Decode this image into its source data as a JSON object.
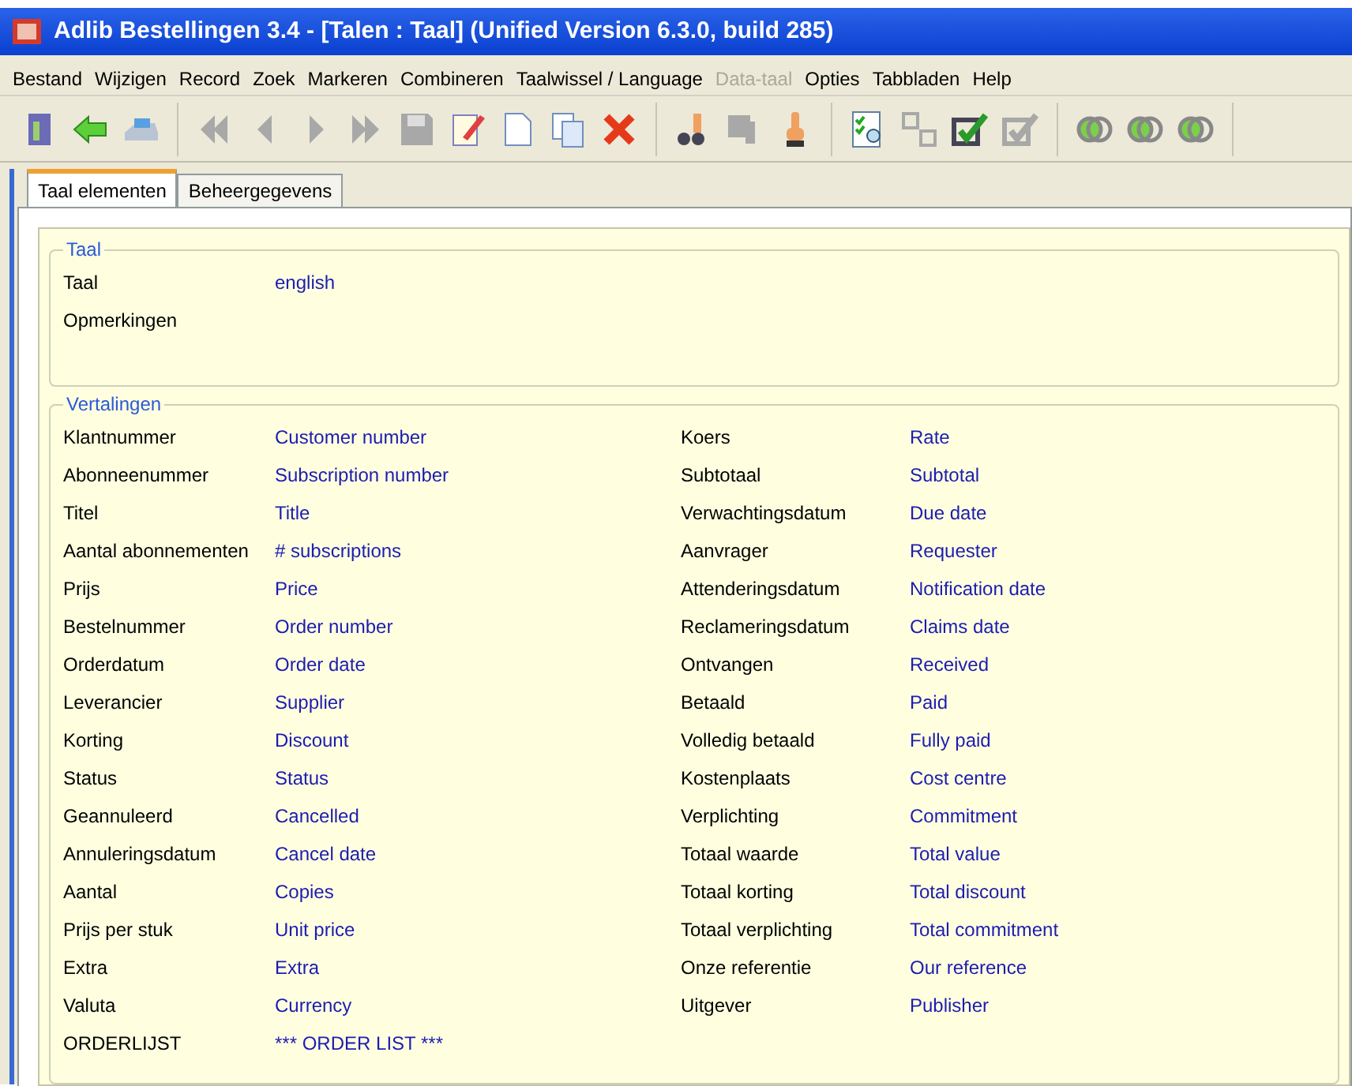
{
  "window": {
    "title": "Adlib Bestellingen 3.4 - [Talen : Taal] (Unified Version 6.3.0, build 285)"
  },
  "menu": [
    {
      "label": "Bestand",
      "disabled": false
    },
    {
      "label": "Wijzigen",
      "disabled": false
    },
    {
      "label": "Record",
      "disabled": false
    },
    {
      "label": "Zoek",
      "disabled": false
    },
    {
      "label": "Markeren",
      "disabled": false
    },
    {
      "label": "Combineren",
      "disabled": false
    },
    {
      "label": "Taalwissel / Language",
      "disabled": false
    },
    {
      "label": "Data-taal",
      "disabled": true
    },
    {
      "label": "Opties",
      "disabled": false
    },
    {
      "label": "Tabbladen",
      "disabled": false
    },
    {
      "label": "Help",
      "disabled": false
    }
  ],
  "toolbar": [
    [
      {
        "kind": "door",
        "disabled": false
      },
      {
        "kind": "back",
        "disabled": false
      },
      {
        "kind": "print",
        "disabled": false
      }
    ],
    [
      {
        "kind": "first",
        "disabled": true
      },
      {
        "kind": "prev",
        "disabled": true
      },
      {
        "kind": "next",
        "disabled": true
      },
      {
        "kind": "last",
        "disabled": true
      },
      {
        "kind": "save",
        "disabled": true
      },
      {
        "kind": "edit",
        "disabled": false
      },
      {
        "kind": "new",
        "disabled": false
      },
      {
        "kind": "copy",
        "disabled": false
      },
      {
        "kind": "delete",
        "disabled": false
      }
    ],
    [
      {
        "kind": "pointsearch",
        "disabled": false
      },
      {
        "kind": "pointsave",
        "disabled": true
      },
      {
        "kind": "point",
        "disabled": false
      }
    ],
    [
      {
        "kind": "checksearch",
        "disabled": false
      },
      {
        "kind": "swap",
        "disabled": true
      },
      {
        "kind": "check",
        "disabled": false
      },
      {
        "kind": "check",
        "disabled": true
      }
    ],
    [
      {
        "kind": "rings",
        "disabled": false
      },
      {
        "kind": "rings",
        "disabled": false
      },
      {
        "kind": "rings",
        "disabled": false
      }
    ]
  ],
  "tabs": [
    {
      "label": "Taal elementen",
      "selected": true
    },
    {
      "label": "Beheergegevens",
      "selected": false
    }
  ],
  "taal_group": {
    "title": "Taal",
    "fields": [
      {
        "label": "Taal",
        "value": "english"
      },
      {
        "label": "Opmerkingen"
      }
    ]
  },
  "vertalingen": {
    "title": "Vertalingen",
    "left": [
      {
        "label": "Klantnummer",
        "value": "Customer number"
      },
      {
        "label": "Abonneenummer",
        "value": "Subscription number"
      },
      {
        "label": "Titel",
        "value": "Title"
      },
      {
        "label": "Aantal abonnementen",
        "value": "# subscriptions"
      },
      {
        "label": "Prijs",
        "value": "Price"
      },
      {
        "label": "Bestelnummer",
        "value": "Order number"
      },
      {
        "label": "Orderdatum",
        "value": "Order date"
      },
      {
        "label": "Leverancier",
        "value": "Supplier"
      },
      {
        "label": "Korting",
        "value": "Discount"
      },
      {
        "label": "Status",
        "value": "Status"
      },
      {
        "label": "Geannuleerd",
        "value": "Cancelled"
      },
      {
        "label": "Annuleringsdatum",
        "value": "Cancel date"
      },
      {
        "label": "Aantal",
        "value": "Copies"
      },
      {
        "label": "Prijs per stuk",
        "value": "Unit price"
      },
      {
        "label": "Extra",
        "value": "Extra"
      },
      {
        "label": "Valuta",
        "value": "Currency"
      },
      {
        "label": "ORDERLIJST",
        "value": "*** ORDER LIST ***"
      }
    ],
    "right": [
      {
        "label": "Koers",
        "value": "Rate"
      },
      {
        "label": "Subtotaal",
        "value": "Subtotal"
      },
      {
        "label": "Verwachtingsdatum",
        "value": "Due date"
      },
      {
        "label": "Aanvrager",
        "value": "Requester"
      },
      {
        "label": "Attenderingsdatum",
        "value": "Notification date"
      },
      {
        "label": "Reclameringsdatum",
        "value": "Claims date"
      },
      {
        "label": "Ontvangen",
        "value": "Received"
      },
      {
        "label": "Betaald",
        "value": "Paid"
      },
      {
        "label": "Volledig betaald",
        "value": "Fully paid"
      },
      {
        "label": "Kostenplaats",
        "value": "Cost centre"
      },
      {
        "label": "Verplichting",
        "value": "Commitment"
      },
      {
        "label": "Totaal waarde",
        "value": "Total value"
      },
      {
        "label": "Totaal korting",
        "value": "Total discount"
      },
      {
        "label": "Totaal verplichting",
        "value": "Total commitment"
      },
      {
        "label": "Onze referentie",
        "value": "Our reference"
      },
      {
        "label": "Uitgever",
        "value": "Publisher"
      }
    ]
  }
}
